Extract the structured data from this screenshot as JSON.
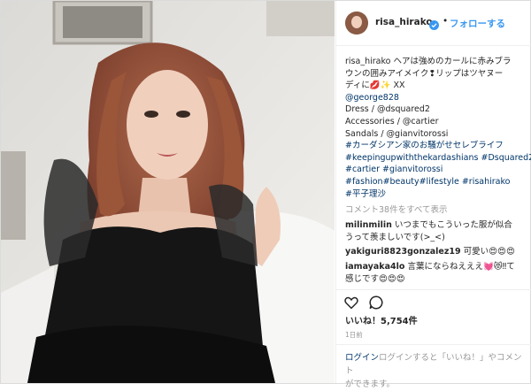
{
  "post": {
    "username": "risa_hirako",
    "dot": "•",
    "follow_label": "フォローする"
  },
  "caption": {
    "line1": "risa_hirako ヘアは強めのカールに赤みブラ",
    "line2": "ウンの囲みアイメイク❢リップはツヤヌー",
    "line3": "ディに💋✨ XX",
    "line4": "@george828",
    "line5": "Dress / @dsquared2",
    "line6": "Accessories / @cartier",
    "line7": "Sandals / @gianvitorossi",
    "line8": "#カーダシアン家のお騒がせセレブライフ",
    "line9": "#keepingupwiththekardashians #Dsquared2",
    "line10": "#cartier #gianvitorossi",
    "line11": "#fashion#beauty#lifestyle #risahirako",
    "line12": "#平子理沙"
  },
  "view_all_comments": "コメント38件をすべて表示",
  "comments": [
    {
      "user": "milinmilin",
      "text": "いつまでもこういった服が似合",
      "text2": "うって羨ましいです(>_<)"
    },
    {
      "user": "yakiguri8823gonzalez19",
      "text": "可愛い😍😍😍",
      "text2": ""
    },
    {
      "user": "iamayaka4lo",
      "text": "言葉にならねえええ💓😻‼て",
      "text2": "感じです😍😍😍"
    }
  ],
  "likes_label": "いいね！5,754件",
  "timestamp": "1日前",
  "login_prompt": {
    "line1_prefix": "ログインすると「いいね！」やコメント",
    "line2": "ができます。",
    "link": "ログイン"
  },
  "colors": {
    "accent_blue": "#3897f0",
    "hashtag_blue": "#003569",
    "muted_gray": "#999999",
    "divider": "#efefef"
  },
  "icons": [
    "verified-badge-icon",
    "heart-icon",
    "comment-icon"
  ]
}
